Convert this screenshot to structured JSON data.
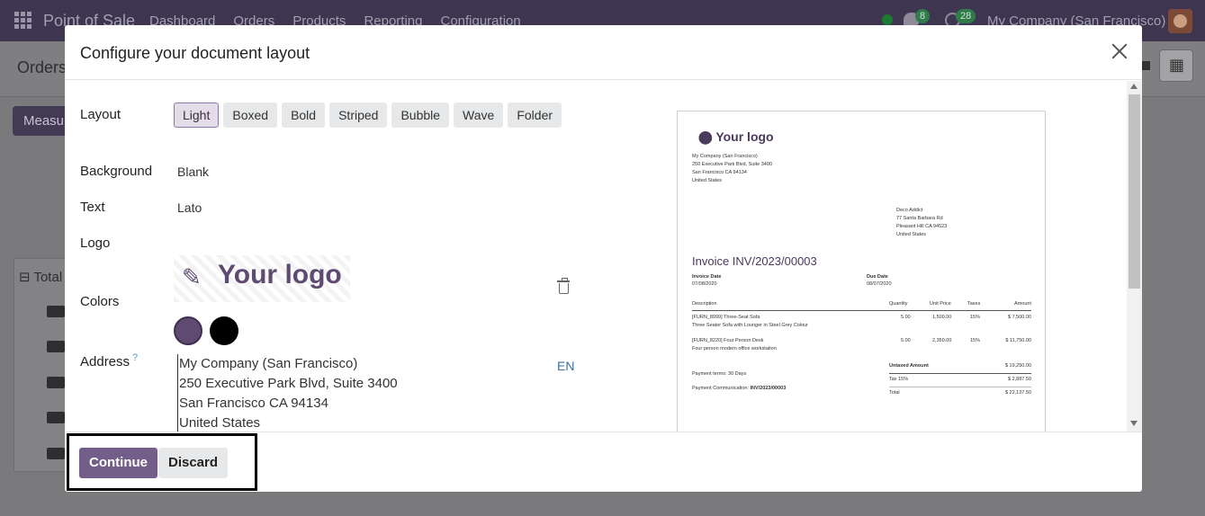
{
  "app": {
    "title": "Point of Sale",
    "menu": [
      "Dashboard",
      "Orders",
      "Products",
      "Reporting",
      "Configuration"
    ],
    "chat_badge": "8",
    "activity_badge": "28",
    "company": "My Company (San Francisco)",
    "breadcrumb": "Orders",
    "measures_btn": "Measu",
    "total_label": "Total"
  },
  "modal": {
    "title": "Configure your document layout",
    "layout_label": "Layout",
    "layouts": [
      "Light",
      "Boxed",
      "Bold",
      "Striped",
      "Bubble",
      "Wave",
      "Folder"
    ],
    "active_layout": "Light",
    "background_label": "Background",
    "background_value": "Blank",
    "text_label": "Text",
    "text_value": "Lato",
    "logo_label": "Logo",
    "logo_text": "Your logo",
    "colors_label": "Colors",
    "colors": [
      "#5f4a72",
      "#000000"
    ],
    "address_label": "Address",
    "help_mark": "?",
    "address_lines": [
      "My Company (San Francisco)",
      "250 Executive Park Blvd, Suite 3400",
      "San Francisco CA 94134",
      "United States"
    ],
    "lang": "EN",
    "continue_label": "Continue",
    "discard_label": "Discard"
  },
  "preview": {
    "logo": "Your logo",
    "company_lines": [
      "My Company (San Francisco)",
      "250 Executive Park Blvd, Suite 3400",
      "San Francisco CA 94134",
      "United States"
    ],
    "customer_lines": [
      "Deco Addict",
      "77 Santa Barbara Rd",
      "Pleasant Hill CA 94523",
      "United States"
    ],
    "invoice_title": "Invoice INV/2023/00003",
    "invoice_date_label": "Invoice Date",
    "invoice_date": "07/08/2020",
    "due_date_label": "Due Date",
    "due_date": "08/07/2020",
    "columns": [
      "Description",
      "Quantity",
      "Unit Price",
      "Taxes",
      "Amount"
    ],
    "lines": [
      {
        "desc1": "[FURN_8999] Three-Seat Sofa",
        "desc2": "Three Seater Sofa with Lounger in Steel Grey Colour",
        "qty": "5.00",
        "price": "1,500.00",
        "tax": "15%",
        "amount": "$ 7,500.00"
      },
      {
        "desc1": "[FURN_8220] Four Person Desk",
        "desc2": "Four person modern office workstation",
        "qty": "5.00",
        "price": "2,350.00",
        "tax": "15%",
        "amount": "$ 11,750.00"
      }
    ],
    "payment_terms": "Payment terms: 30 Days",
    "payment_comm_label": "Payment Communication:",
    "payment_comm_value": "INV/2023/00003",
    "untaxed_label": "Untaxed Amount",
    "untaxed_value": "$ 19,250.00",
    "tax_label": "Tax 15%",
    "tax_value": "$ 2,887.50",
    "total_label": "Total",
    "total_value": "$ 22,137.50"
  }
}
